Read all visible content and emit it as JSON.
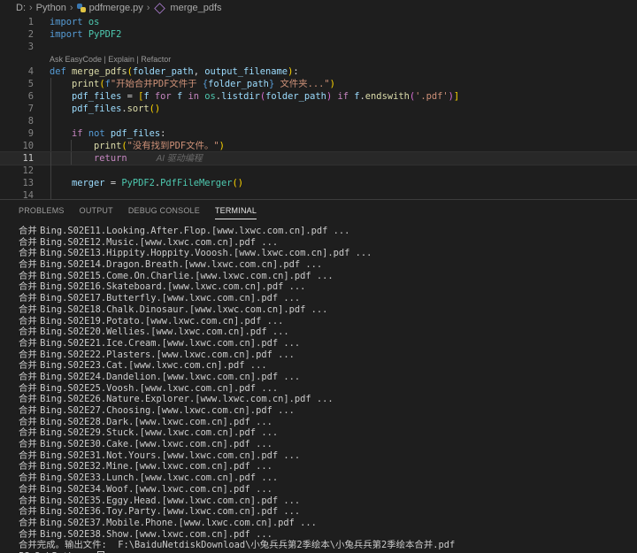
{
  "breadcrumb": [
    "D:",
    "Python",
    "pdfmerge.py",
    "merge_pdfs"
  ],
  "editor": {
    "current_line": "11",
    "codelens": "Ask EasyCode | Explain | Refactor",
    "ghost_text": "AI 驱动编程",
    "lines": [
      {
        "n": "1",
        "tokens": [
          [
            "kw",
            "import"
          ],
          [
            "plain",
            " "
          ],
          [
            "mod",
            "os"
          ]
        ]
      },
      {
        "n": "2",
        "tokens": [
          [
            "kw",
            "import"
          ],
          [
            "plain",
            " "
          ],
          [
            "mod",
            "PyPDF2"
          ]
        ]
      },
      {
        "n": "3",
        "tokens": []
      },
      {
        "n": "4",
        "tokens": [
          [
            "kw",
            "def"
          ],
          [
            "plain",
            " "
          ],
          [
            "fn",
            "merge_pdfs"
          ],
          [
            "br1",
            "("
          ],
          [
            "var",
            "folder_path"
          ],
          [
            "plain",
            ", "
          ],
          [
            "var",
            "output_filename"
          ],
          [
            "br1",
            ")"
          ],
          [
            "plain",
            ":"
          ]
        ]
      },
      {
        "n": "5",
        "tokens": [
          [
            "plain",
            "    "
          ],
          [
            "fn",
            "print"
          ],
          [
            "br1",
            "("
          ],
          [
            "fstr",
            "f"
          ],
          [
            "str",
            "\"开始合并PDF文件于 "
          ],
          [
            "fstr",
            "{"
          ],
          [
            "var",
            "folder_path"
          ],
          [
            "fstr",
            "}"
          ],
          [
            "str",
            " 文件夹...\""
          ],
          [
            "br1",
            ")"
          ]
        ]
      },
      {
        "n": "6",
        "tokens": [
          [
            "plain",
            "    "
          ],
          [
            "var",
            "pdf_files"
          ],
          [
            "plain",
            " = "
          ],
          [
            "br1",
            "["
          ],
          [
            "var",
            "f"
          ],
          [
            "plain",
            " "
          ],
          [
            "ctl",
            "for"
          ],
          [
            "plain",
            " "
          ],
          [
            "var",
            "f"
          ],
          [
            "plain",
            " "
          ],
          [
            "ctl",
            "in"
          ],
          [
            "plain",
            " "
          ],
          [
            "mod",
            "os"
          ],
          [
            "plain",
            "."
          ],
          [
            "var",
            "listdir"
          ],
          [
            "br2",
            "("
          ],
          [
            "var",
            "folder_path"
          ],
          [
            "br2",
            ")"
          ],
          [
            "plain",
            " "
          ],
          [
            "ctl",
            "if"
          ],
          [
            "plain",
            " "
          ],
          [
            "var",
            "f"
          ],
          [
            "plain",
            "."
          ],
          [
            "fn",
            "endswith"
          ],
          [
            "br2",
            "("
          ],
          [
            "str",
            "'.pdf'"
          ],
          [
            "br2",
            ")"
          ],
          [
            "br1",
            "]"
          ]
        ]
      },
      {
        "n": "7",
        "tokens": [
          [
            "plain",
            "    "
          ],
          [
            "var",
            "pdf_files"
          ],
          [
            "plain",
            "."
          ],
          [
            "fn",
            "sort"
          ],
          [
            "br1",
            "()"
          ]
        ]
      },
      {
        "n": "8",
        "tokens": []
      },
      {
        "n": "9",
        "tokens": [
          [
            "plain",
            "    "
          ],
          [
            "ctl",
            "if"
          ],
          [
            "plain",
            " "
          ],
          [
            "kw",
            "not"
          ],
          [
            "plain",
            " "
          ],
          [
            "var",
            "pdf_files"
          ],
          [
            "plain",
            ":"
          ]
        ]
      },
      {
        "n": "10",
        "tokens": [
          [
            "plain",
            "        "
          ],
          [
            "fn",
            "print"
          ],
          [
            "br1",
            "("
          ],
          [
            "str",
            "\"没有找到PDF文件。\""
          ],
          [
            "br1",
            ")"
          ]
        ]
      },
      {
        "n": "11",
        "tokens": [
          [
            "plain",
            "        "
          ],
          [
            "ctl",
            "return"
          ]
        ]
      },
      {
        "n": "12",
        "tokens": []
      },
      {
        "n": "13",
        "tokens": [
          [
            "plain",
            "    "
          ],
          [
            "var",
            "merger"
          ],
          [
            "plain",
            " = "
          ],
          [
            "mod",
            "PyPDF2"
          ],
          [
            "plain",
            "."
          ],
          [
            "mod",
            "PdfFileMerger"
          ],
          [
            "br1",
            "()"
          ]
        ]
      },
      {
        "n": "14",
        "tokens": []
      }
    ]
  },
  "panel": {
    "tabs": [
      "PROBLEMS",
      "OUTPUT",
      "DEBUG CONSOLE",
      "TERMINAL"
    ],
    "active_tab": "TERMINAL"
  },
  "terminal": {
    "merge_prefix": "合并",
    "lines": [
      "Bing.S02E11.Looking.After.Flop.[www.lxwc.com.cn].pdf ...",
      "Bing.S02E12.Music.[www.lxwc.com.cn].pdf ...",
      "Bing.S02E13.Hippity.Hoppity.Vooosh.[www.lxwc.com.cn].pdf ...",
      "Bing.S02E14.Dragon.Breath.[www.lxwc.com.cn].pdf ...",
      "Bing.S02E15.Come.On.Charlie.[www.lxwc.com.cn].pdf ...",
      "Bing.S02E16.Skateboard.[www.lxwc.com.cn].pdf ...",
      "Bing.S02E17.Butterfly.[www.lxwc.com.cn].pdf ...",
      "Bing.S02E18.Chalk.Dinosaur.[www.lxwc.com.cn].pdf ...",
      "Bing.S02E19.Potato.[www.lxwc.com.cn].pdf ...",
      "Bing.S02E20.Wellies.[www.lxwc.com.cn].pdf ...",
      "Bing.S02E21.Ice.Cream.[www.lxwc.com.cn].pdf ...",
      "Bing.S02E22.Plasters.[www.lxwc.com.cn].pdf ...",
      "Bing.S02E23.Cat.[www.lxwc.com.cn].pdf ...",
      "Bing.S02E24.Dandelion.[www.lxwc.com.cn].pdf ...",
      "Bing.S02E25.Voosh.[www.lxwc.com.cn].pdf ...",
      "Bing.S02E26.Nature.Explorer.[www.lxwc.com.cn].pdf ...",
      "Bing.S02E27.Choosing.[www.lxwc.com.cn].pdf ...",
      "Bing.S02E28.Dark.[www.lxwc.com.cn].pdf ...",
      "Bing.S02E29.Stuck.[www.lxwc.com.cn].pdf ...",
      "Bing.S02E30.Cake.[www.lxwc.com.cn].pdf ...",
      "Bing.S02E31.Not.Yours.[www.lxwc.com.cn].pdf ...",
      "Bing.S02E32.Mine.[www.lxwc.com.cn].pdf ...",
      "Bing.S02E33.Lunch.[www.lxwc.com.cn].pdf ...",
      "Bing.S02E34.Woof.[www.lxwc.com.cn].pdf ...",
      "Bing.S02E35.Eggy.Head.[www.lxwc.com.cn].pdf ...",
      "Bing.S02E36.Toy.Party.[www.lxwc.com.cn].pdf ...",
      "Bing.S02E37.Mobile.Phone.[www.lxwc.com.cn].pdf ...",
      "Bing.S02E38.Show.[www.lxwc.com.cn].pdf ..."
    ],
    "done_line": "合并完成。输出文件:  F:\\BaiduNetdiskDownload\\小兔兵兵第2季绘本\\小兔兵兵第2季绘本合并.pdf",
    "prompt": "PS D:\\Python> "
  }
}
